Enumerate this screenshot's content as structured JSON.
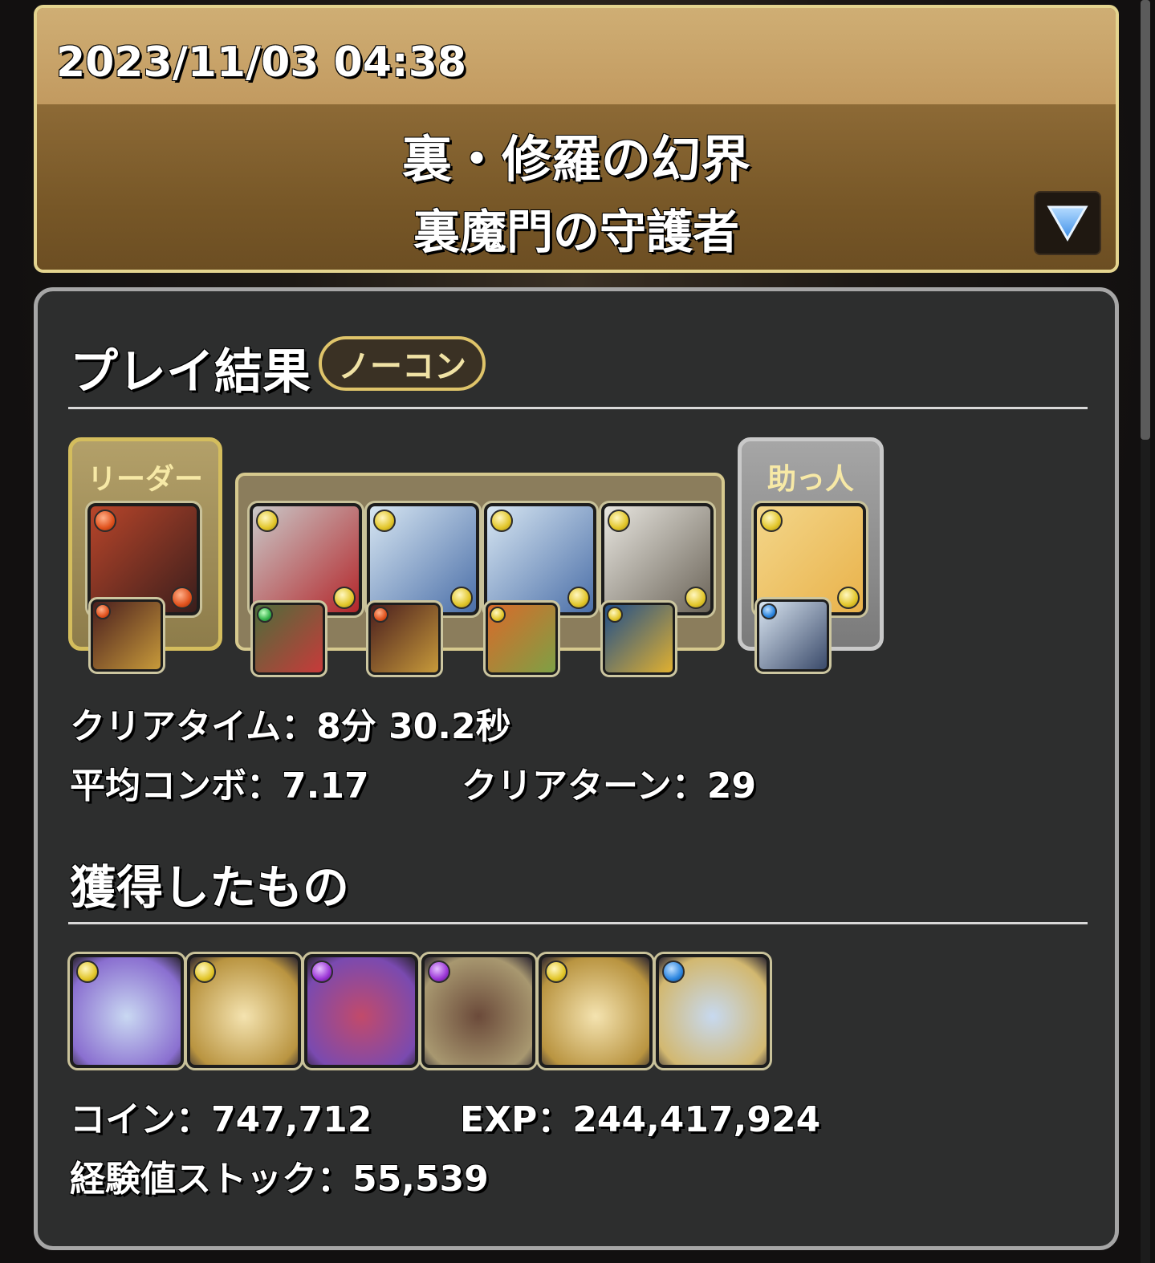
{
  "header": {
    "datetime": "2023/11/03 04:38",
    "dungeon_name": "裏・修羅の幻界",
    "floor_name": "裏魔門の守護者",
    "expand_icon": "triangle-down-icon"
  },
  "result": {
    "section_title": "プレイ結果",
    "badge": "ノーコン",
    "leader_label": "リーダー",
    "helper_label": "助っ人",
    "team": [
      {
        "role": "leader",
        "attribute": "fire",
        "colors": [
          "#b8452a",
          "#3a1e1c"
        ],
        "assist_attribute": "fire",
        "assist_colors": [
          "#4a1e1e",
          "#c79a3a"
        ]
      },
      {
        "role": "sub",
        "attribute": "light",
        "colors": [
          "#c9c9c9",
          "#b3262a"
        ],
        "assist_attribute": "wood",
        "assist_colors": [
          "#4d6d3a",
          "#c83a3a"
        ]
      },
      {
        "role": "sub",
        "attribute": "light",
        "colors": [
          "#d7e6f2",
          "#4b6fa8"
        ],
        "assist_attribute": "fire",
        "assist_colors": [
          "#4a1e1e",
          "#c79a3a"
        ]
      },
      {
        "role": "sub",
        "attribute": "light",
        "colors": [
          "#d7e6f2",
          "#4b6fa8"
        ],
        "assist_attribute": "light",
        "assist_colors": [
          "#d96a2a",
          "#7ea045"
        ]
      },
      {
        "role": "sub",
        "attribute": "light",
        "colors": [
          "#e8e6e0",
          "#6b6458"
        ],
        "assist_attribute": "light",
        "assist_colors": [
          "#1f4e8a",
          "#e0b030"
        ]
      },
      {
        "role": "helper",
        "attribute": "light",
        "colors": [
          "#f3d68a",
          "#e9b24a"
        ],
        "assist_attribute": "water",
        "assist_colors": [
          "#d8e4f0",
          "#3a4a6a"
        ]
      }
    ],
    "clear_time_label": "クリアタイム：8分 30.2秒",
    "avg_combo_label": "平均コンボ：7.17",
    "clear_turn_label": "クリアターン：29"
  },
  "rewards": {
    "section_title": "獲得したもの",
    "drops": [
      {
        "attribute": "light",
        "colors": [
          "#c9d8f2",
          "#8a6fd0"
        ]
      },
      {
        "attribute": "light",
        "colors": [
          "#f4e3b0",
          "#b99440"
        ]
      },
      {
        "attribute": "dark",
        "colors": [
          "#c24a6a",
          "#7a4ab0"
        ]
      },
      {
        "attribute": "dark",
        "colors": [
          "#6b4a3a",
          "#a89870"
        ]
      },
      {
        "attribute": "light",
        "colors": [
          "#f4e3b0",
          "#b99440"
        ]
      },
      {
        "attribute": "water",
        "colors": [
          "#c7d9f0",
          "#d2b870"
        ]
      }
    ],
    "coin_label": "コイン：747,712",
    "exp_label": "EXP：244,417,924",
    "exp_stock_label": "経験値ストック：55,539"
  }
}
